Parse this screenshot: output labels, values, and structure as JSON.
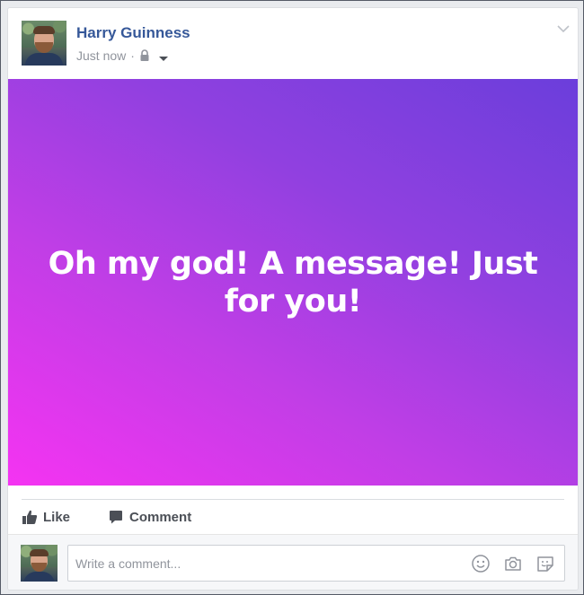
{
  "post": {
    "author_name": "Harry Guinness",
    "timestamp": "Just now",
    "separator": "·",
    "privacy_icon": "lock-icon",
    "text": "Oh my god! A message! Just for you!",
    "gradient_colors": [
      "#f533f2",
      "#c13ee6",
      "#9140e0",
      "#6b3edb"
    ]
  },
  "actions": {
    "like_label": "Like",
    "comment_label": "Comment"
  },
  "composer": {
    "placeholder": "Write a comment...",
    "icons": [
      "emoji-icon",
      "camera-icon",
      "sticker-icon"
    ]
  },
  "colors": {
    "author_link": "#365899",
    "meta_gray": "#90949c",
    "action_text": "#4b4f56"
  }
}
